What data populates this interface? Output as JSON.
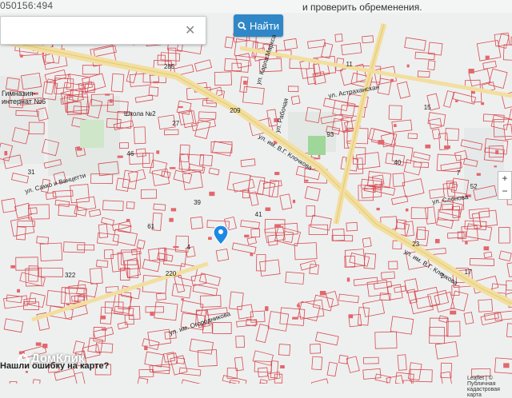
{
  "header": {
    "cadastral_number": "050156:494",
    "hint": "и проверить обременения."
  },
  "search": {
    "value": "",
    "button_label": "Найти"
  },
  "map": {
    "streets": [
      {
        "name": "ул. им. В.Г. Клочкова"
      },
      {
        "name": "ул. им. В.Г. Клочкова"
      },
      {
        "name": "ул. им. Огородникова"
      },
      {
        "name": "ул. Карла Маркса"
      },
      {
        "name": "ул. Астраханская"
      },
      {
        "name": "ул. Слонова"
      },
      {
        "name": "ул. Рабочая"
      },
      {
        "name": "ул. Сакко и Ванцетти"
      }
    ],
    "places": [
      {
        "name": "Гимназия-интернат №6"
      },
      {
        "name": "Школа №2"
      }
    ],
    "house_numbers": [
      "27",
      "7",
      "93",
      "52",
      "39",
      "17",
      "4",
      "11",
      "2",
      "15",
      "46",
      "23",
      "40",
      "220",
      "322",
      "41",
      "61",
      "31",
      "285",
      "209"
    ]
  },
  "footer": {
    "brand": "ДомКлик",
    "question": "Нашли ошибку на карте?",
    "attribution": "Leaflet | © Публичная кадастровая карта"
  },
  "colors": {
    "accent": "#2f87c8",
    "parcel_line": "#d84b52",
    "road": "#f2dfa0",
    "marker": "#1e88e5"
  }
}
